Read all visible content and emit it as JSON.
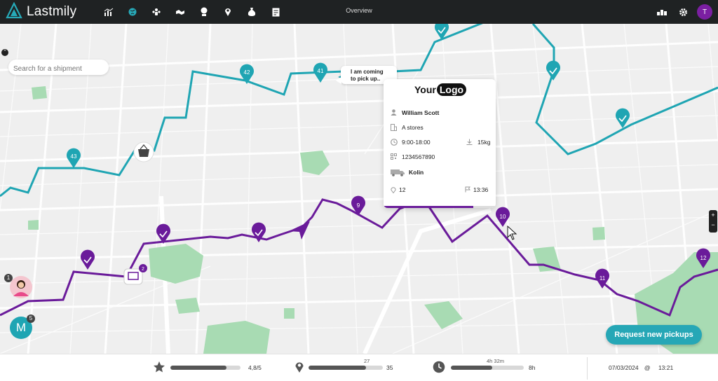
{
  "app": {
    "name": "Lastmily",
    "view_title": "Overview",
    "user_initial": "T"
  },
  "nav": {
    "items": [
      "dashboard-chart-icon",
      "globe-icon",
      "team-icon",
      "handshake-icon",
      "coins-icon",
      "location-pin-icon",
      "money-bag-icon",
      "invoice-icon"
    ]
  },
  "topright": {
    "icons": [
      "warehouse-icon",
      "gear-icon"
    ]
  },
  "search": {
    "placeholder": "Search for a shipment"
  },
  "bubble": {
    "line1": "I am coming",
    "line2": "to pick up.."
  },
  "card": {
    "logo_a": "Your",
    "logo_b": "Logo",
    "name": "William Scott",
    "store": "A stores",
    "hours": "9:00-18:00",
    "weight": "15kg",
    "phone": "1234567890",
    "vehicle": "Kolin",
    "stops": "12",
    "eta": "13:36",
    "progress": 0.8
  },
  "markers": {
    "teal": [
      "43",
      "42",
      "41"
    ],
    "purple": [
      "9",
      "10",
      "11",
      "12"
    ]
  },
  "agents": [
    {
      "initial": "",
      "count": "1"
    },
    {
      "initial": "M",
      "count": "5"
    }
  ],
  "pickup_badge": "2",
  "map_controls": {
    "zoom_in": "+",
    "zoom_out": "−",
    "collapse": "⌃"
  },
  "request_button": "Request new pickups",
  "metrics": {
    "rating": {
      "value": "4,8/5",
      "fraction": 0.8
    },
    "stops": {
      "done": "27",
      "total": "35",
      "fraction": 0.77
    },
    "time": {
      "elapsed": "4h 32m",
      "total": "8h",
      "fraction": 0.57
    }
  },
  "datetime": {
    "date": "07/03/2024",
    "at": "@",
    "time": "13:21"
  },
  "colors": {
    "teal": "#1fa5b3",
    "purple": "#6a1b9a",
    "park": "#a8dbb3",
    "topbar": "#1f2223"
  }
}
